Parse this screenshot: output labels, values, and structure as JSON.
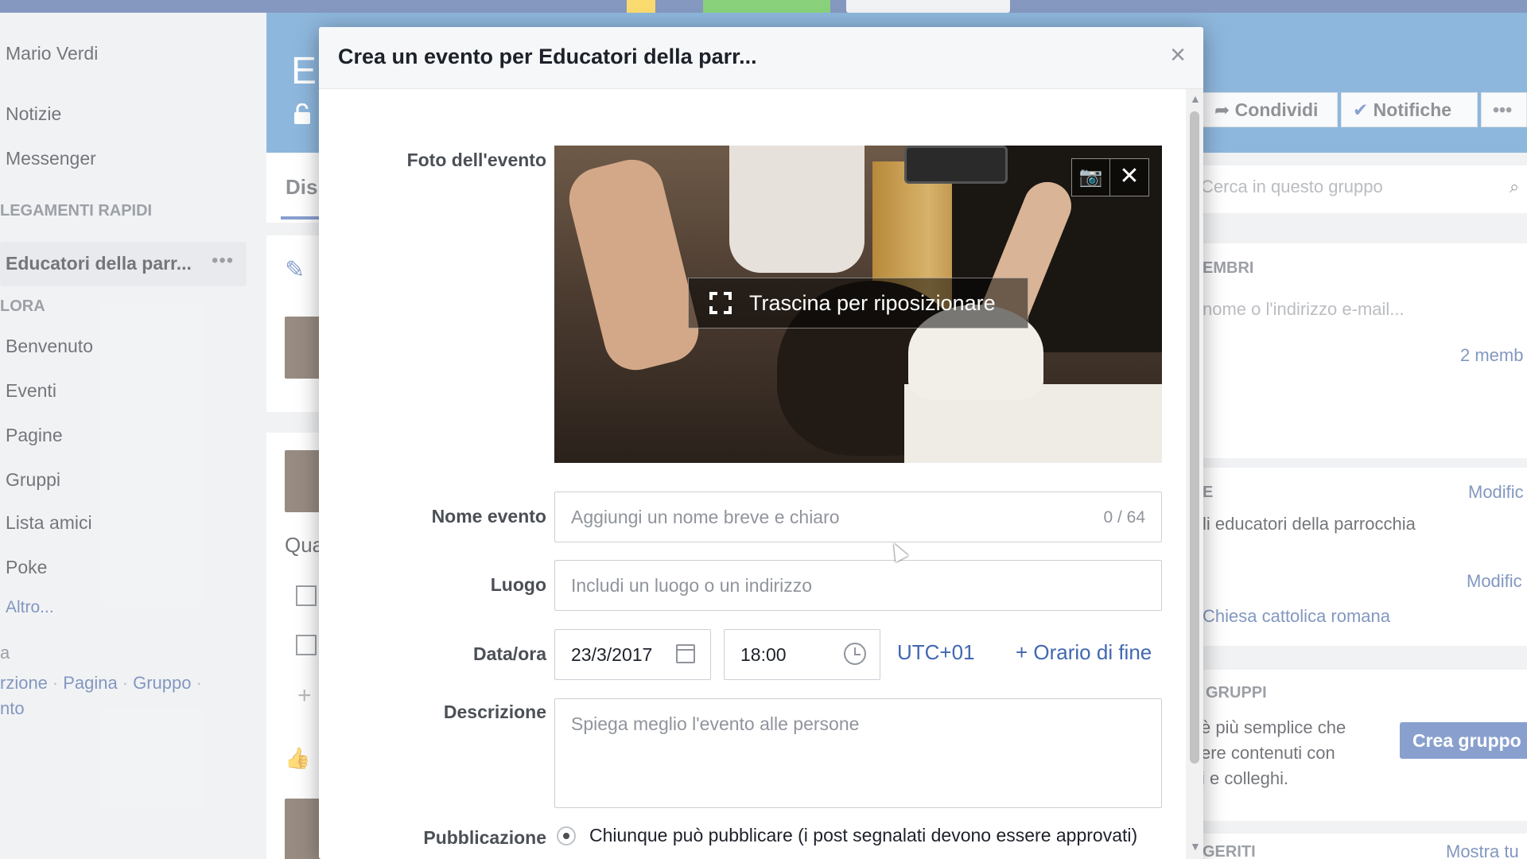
{
  "background": {
    "left_nav": {
      "user_name": "Mario Verdi",
      "items_top": [
        "Notizie",
        "Messenger"
      ],
      "quick_links_heading": "LEGAMENTI RAPIDI",
      "active_group": "Educatori della parr...",
      "explore_heading": "LORA",
      "explore_items": [
        "Benvenuto",
        "Eventi",
        "Pagine",
        "Gruppi",
        "Lista amici",
        "Poke"
      ],
      "more_link": "Altro...",
      "create_prefix": "a",
      "create_links": [
        "rzione",
        "Pagina",
        "Gruppo"
      ],
      "create_suffix": "nto"
    },
    "group": {
      "cover_initial": "E",
      "tab_label": "Dis",
      "post_prompt": "Qua"
    },
    "right_col": {
      "share_button": "Condividi",
      "notifications_button": "Notifiche",
      "more_button": "•••",
      "search_placeholder": "Cerca in questo gruppo",
      "members_heading": "EMBRI",
      "add_member_placeholder": "nome o l'indirizzo e-mail...",
      "members_count": "2 memb",
      "description_heading": "E",
      "edit_link_1": "Modific",
      "description_text": "li educatori della parrocchia",
      "edit_link_2": "Modific",
      "location_text": "Chiesa cattolica romana",
      "groups_heading": "GRUPPI",
      "groups_text_1": "è più semplice che",
      "groups_text_2": "ere contenuti con",
      "groups_text_3": "i e colleghi.",
      "create_group_button": "Crea gruppo",
      "suggested_heading": "GERITI",
      "show_all_link": "Mostra tu"
    }
  },
  "modal": {
    "title": "Crea un evento per Educatori della parr...",
    "close_label": "×",
    "photo": {
      "label": "Foto dell'evento",
      "drag_hint": "Trascina per riposizionare",
      "camera_glyph": "📷",
      "remove_glyph": "✕"
    },
    "name": {
      "label": "Nome evento",
      "placeholder": "Aggiungi un nome breve e chiaro",
      "counter": "0 / 64"
    },
    "location": {
      "label": "Luogo",
      "placeholder": "Includi un luogo o un indirizzo"
    },
    "datetime": {
      "label": "Data/ora",
      "date": "23/3/2017",
      "time": "18:00",
      "timezone": "UTC+01",
      "end_time_link": "+ Orario di fine"
    },
    "description": {
      "label": "Descrizione",
      "placeholder": "Spiega meglio l'evento alle persone"
    },
    "posting": {
      "label": "Pubblicazione",
      "option": "Chiunque può pubblicare (i post segnalati devono essere approvati)"
    }
  },
  "colors": {
    "brand": "#3b5998",
    "link": "#4267b2",
    "button_primary": "#4267b2"
  }
}
